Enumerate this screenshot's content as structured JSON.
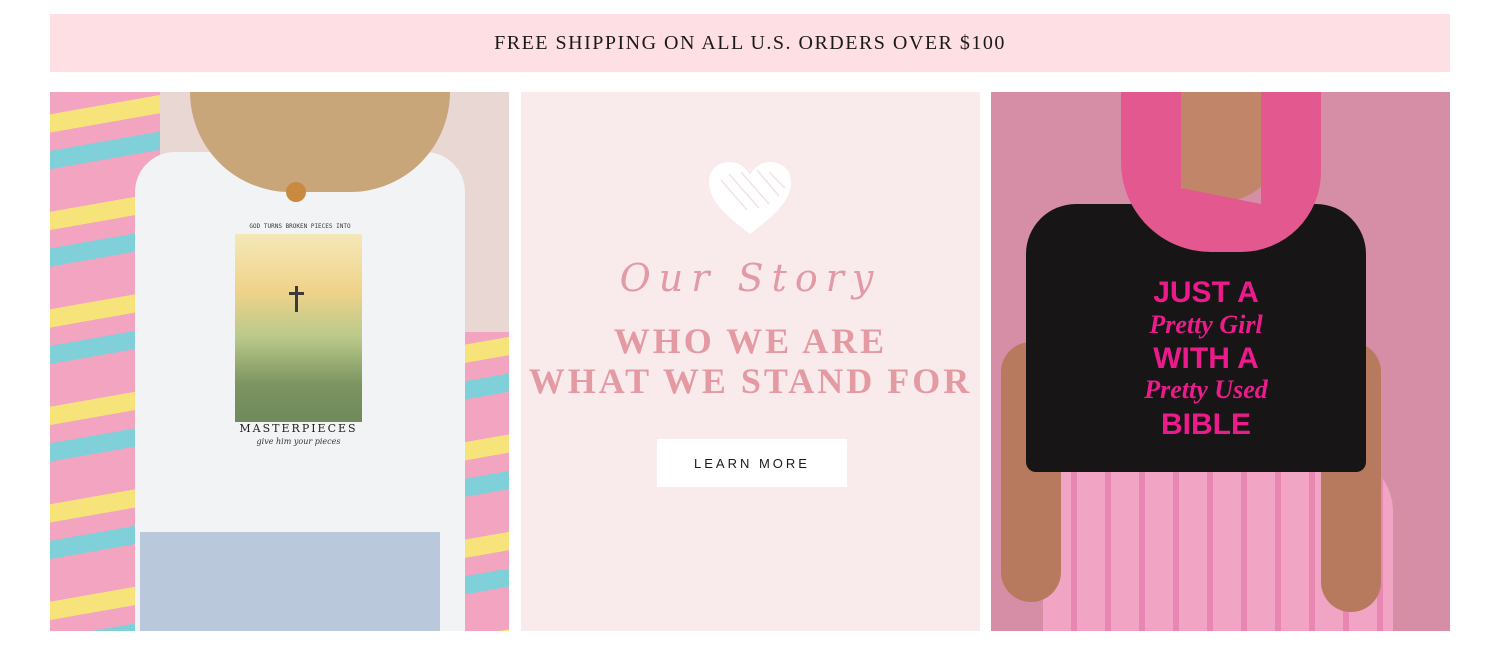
{
  "banner": {
    "text": "FREE SHIPPING ON ALL U.S. ORDERS OVER $100"
  },
  "left_image": {
    "shirt_print_top": "GOD TURNS BROKEN PIECES INTO",
    "shirt_print_main": "MASTERPIECES",
    "shirt_print_sub": "give him your pieces"
  },
  "story": {
    "heart_icon": "heart-icon",
    "script_title": "Our Story",
    "headline_line1": "WHO WE ARE",
    "headline_line2": "WHAT WE STAND FOR",
    "button_label": "LEARN MORE"
  },
  "right_image": {
    "shirt_line1": "JUST A",
    "shirt_line2": "Pretty Girl",
    "shirt_line3": "WITH A",
    "shirt_line4": "Pretty Used",
    "shirt_line5": "BIBLE"
  },
  "colors": {
    "banner_bg": "#fedfe3",
    "story_bg": "#f9ebeb",
    "accent_pink": "#e49aa3",
    "shirt_text_pink": "#ec1b8b"
  }
}
